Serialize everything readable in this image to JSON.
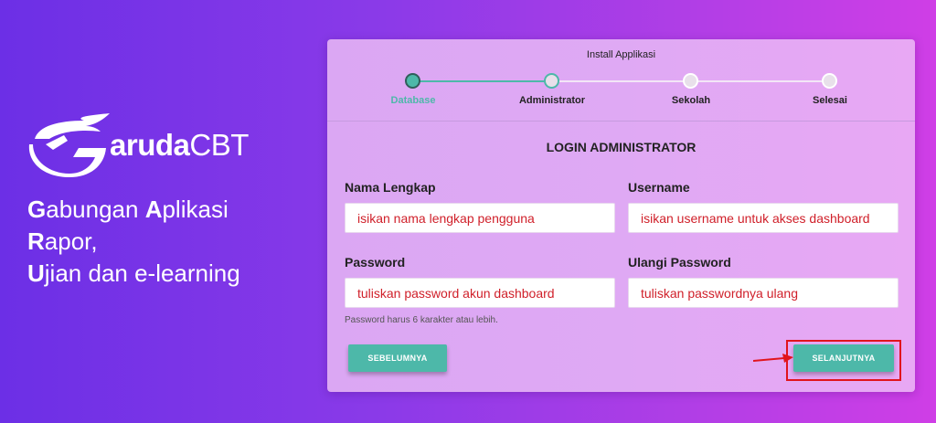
{
  "brand": {
    "logo_name_bold": "aruda",
    "logo_name_thin": "CBT",
    "tagline_lines": [
      {
        "first": "G",
        "rest": "abungan ",
        "first2": "A",
        "rest2": "plikasi"
      },
      {
        "first": "R",
        "rest": "apor,"
      },
      {
        "first": "U",
        "rest": "jian dan e-learning"
      }
    ]
  },
  "install": {
    "title": "Install Applikasi",
    "steps": [
      "Database",
      "Administrator",
      "Sekolah",
      "Selesai"
    ]
  },
  "form": {
    "title": "LOGIN ADMINISTRATOR",
    "full_name_label": "Nama Lengkap",
    "full_name_value": "isikan nama lengkap pengguna",
    "username_label": "Username",
    "username_value": "isikan username untuk akses dashboard",
    "password_label": "Password",
    "password_value": "tuliskan password akun dashboard",
    "repeat_password_label": "Ulangi Password",
    "repeat_password_value": "tuliskan passwordnya ulang",
    "hint": "Password harus 6 karakter atau lebih.",
    "prev_button": "SEBELUMNYA",
    "next_button": "SELANJUTNYA"
  },
  "colors": {
    "accent": "#4db8a9",
    "annotation_red": "#e1141c"
  }
}
